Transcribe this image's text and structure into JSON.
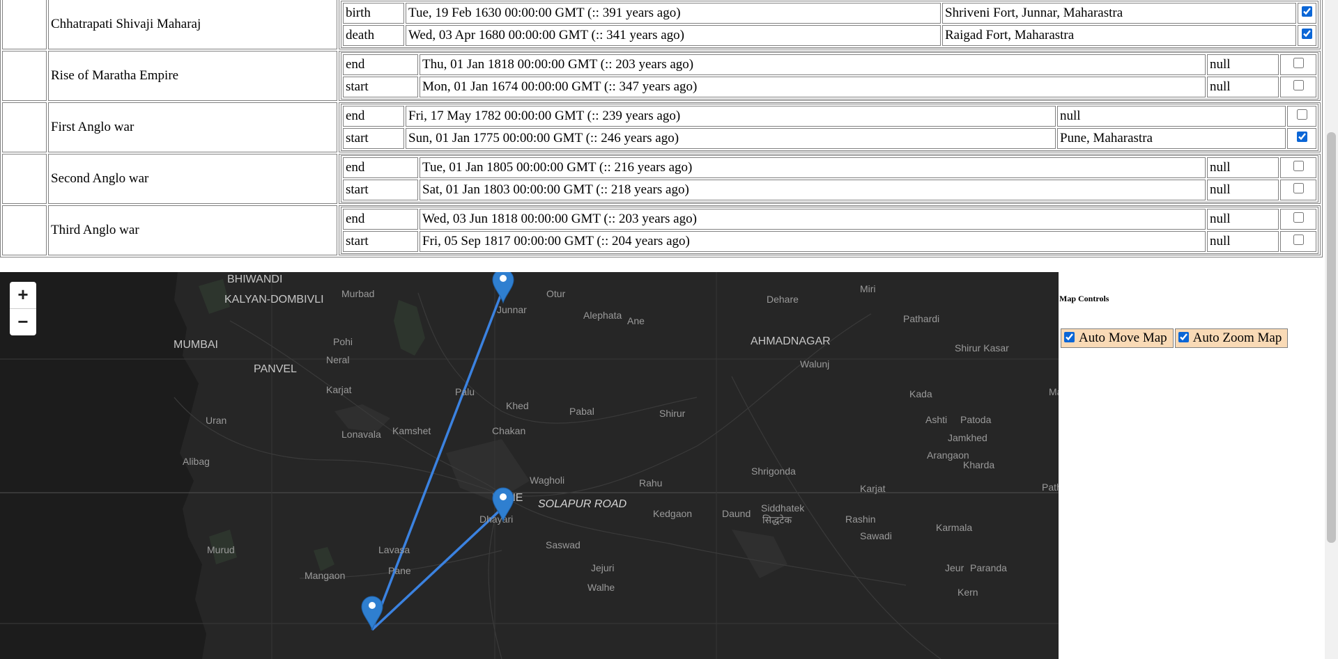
{
  "events": [
    {
      "name": "Chhatrapati Shivaji Maharaj",
      "rows": [
        {
          "type": "birth",
          "date": "Tue, 19 Feb 1630 00:00:00 GMT (:: 391 years ago)",
          "place": "Shriveni Fort, Junnar, Maharastra",
          "checked": true
        },
        {
          "type": "death",
          "date": "Wed, 03 Apr 1680 00:00:00 GMT (:: 341 years ago)",
          "place": "Raigad Fort, Maharastra",
          "checked": true
        }
      ]
    },
    {
      "name": "Rise of Maratha Empire",
      "rows": [
        {
          "type": "end",
          "date": "Thu, 01 Jan 1818 00:00:00 GMT (:: 203 years ago)",
          "place": "null",
          "checked": false
        },
        {
          "type": "start",
          "date": "Mon, 01 Jan 1674 00:00:00 GMT (:: 347 years ago)",
          "place": "null",
          "checked": false
        }
      ]
    },
    {
      "name": "First Anglo war",
      "rows": [
        {
          "type": "end",
          "date": "Fri, 17 May 1782 00:00:00 GMT (:: 239 years ago)",
          "place": "null",
          "checked": false
        },
        {
          "type": "start",
          "date": "Sun, 01 Jan 1775 00:00:00 GMT (:: 246 years ago)",
          "place": "Pune, Maharastra",
          "checked": true
        }
      ]
    },
    {
      "name": "Second Anglo war",
      "rows": [
        {
          "type": "end",
          "date": "Tue, 01 Jan 1805 00:00:00 GMT (:: 216 years ago)",
          "place": "null",
          "checked": false
        },
        {
          "type": "start",
          "date": "Sat, 01 Jan 1803 00:00:00 GMT (:: 218 years ago)",
          "place": "null",
          "checked": false
        }
      ]
    },
    {
      "name": "Third Anglo war",
      "rows": [
        {
          "type": "end",
          "date": "Wed, 03 Jun 1818 00:00:00 GMT (:: 203 years ago)",
          "place": "null",
          "checked": false
        },
        {
          "type": "start",
          "date": "Fri, 05 Sep 1817 00:00:00 GMT (:: 204 years ago)",
          "place": "null",
          "checked": false
        }
      ]
    }
  ],
  "map": {
    "zoom_in_label": "+",
    "zoom_out_label": "−",
    "route_color": "#3b82e0",
    "marker_color": "#2f7fd0",
    "labels": [
      {
        "text": "BHIWANDI",
        "kind": "city"
      },
      {
        "text": "KALYAN-DOMBIVLI",
        "kind": "city"
      },
      {
        "text": "Murbad",
        "kind": "town"
      },
      {
        "text": "MUMBAI",
        "kind": "city"
      },
      {
        "text": "Pohi",
        "kind": "town"
      },
      {
        "text": "Neral",
        "kind": "town"
      },
      {
        "text": "PANVEL",
        "kind": "city"
      },
      {
        "text": "Karjat",
        "kind": "town"
      },
      {
        "text": "Uran",
        "kind": "town"
      },
      {
        "text": "Lonavala",
        "kind": "town"
      },
      {
        "text": "Kamshet",
        "kind": "town"
      },
      {
        "text": "Alibag",
        "kind": "town"
      },
      {
        "text": "Murud",
        "kind": "town"
      },
      {
        "text": "Mangaon",
        "kind": "town"
      },
      {
        "text": "Lavasa",
        "kind": "town"
      },
      {
        "text": "Pane",
        "kind": "town"
      },
      {
        "text": "Otur",
        "kind": "town"
      },
      {
        "text": "Junnar",
        "kind": "town"
      },
      {
        "text": "Alephata",
        "kind": "town"
      },
      {
        "text": "Ane",
        "kind": "town"
      },
      {
        "text": "Palu",
        "kind": "town"
      },
      {
        "text": "Khed",
        "kind": "town"
      },
      {
        "text": "Pabal",
        "kind": "town"
      },
      {
        "text": "Shirur",
        "kind": "town"
      },
      {
        "text": "Chakan",
        "kind": "town"
      },
      {
        "text": "Wagholi",
        "kind": "town"
      },
      {
        "text": "PUNE",
        "kind": "city"
      },
      {
        "text": "SOLAPUR ROAD",
        "kind": "road"
      },
      {
        "text": "Rahu",
        "kind": "town"
      },
      {
        "text": "Dhayari",
        "kind": "town"
      },
      {
        "text": "Saswad",
        "kind": "town"
      },
      {
        "text": "Kedgaon",
        "kind": "town"
      },
      {
        "text": "Daund",
        "kind": "town"
      },
      {
        "text": "Jejuri",
        "kind": "town"
      },
      {
        "text": "Walhe",
        "kind": "town"
      },
      {
        "text": "Miri",
        "kind": "town"
      },
      {
        "text": "Dehare",
        "kind": "town"
      },
      {
        "text": "Pathardi",
        "kind": "town"
      },
      {
        "text": "AHMADNAGAR",
        "kind": "city"
      },
      {
        "text": "Walunj",
        "kind": "town"
      },
      {
        "text": "Shirur Kasar",
        "kind": "town"
      },
      {
        "text": "Kada",
        "kind": "town"
      },
      {
        "text": "Ashti",
        "kind": "town"
      },
      {
        "text": "Patoda",
        "kind": "town"
      },
      {
        "text": "Jamkhed",
        "kind": "town"
      },
      {
        "text": "Arangaon",
        "kind": "town"
      },
      {
        "text": "Kharda",
        "kind": "town"
      },
      {
        "text": "Shrigonda",
        "kind": "town"
      },
      {
        "text": "Karjat",
        "kind": "town"
      },
      {
        "text": "Siddhatek",
        "kind": "town"
      },
      {
        "text": "सिद्धटेक",
        "kind": "town"
      },
      {
        "text": "Rashin",
        "kind": "town"
      },
      {
        "text": "Sawadi",
        "kind": "town"
      },
      {
        "text": "Karmala",
        "kind": "town"
      },
      {
        "text": "Jeur",
        "kind": "town"
      },
      {
        "text": "Paranda",
        "kind": "town"
      },
      {
        "text": "Kern",
        "kind": "town"
      },
      {
        "text": "Ma",
        "kind": "town"
      },
      {
        "text": "Path",
        "kind": "town"
      }
    ]
  },
  "controls": {
    "title": "Map Controls",
    "auto_move_label": "Auto Move Map",
    "auto_move_checked": true,
    "auto_zoom_label": "Auto Zoom Map",
    "auto_zoom_checked": true
  }
}
